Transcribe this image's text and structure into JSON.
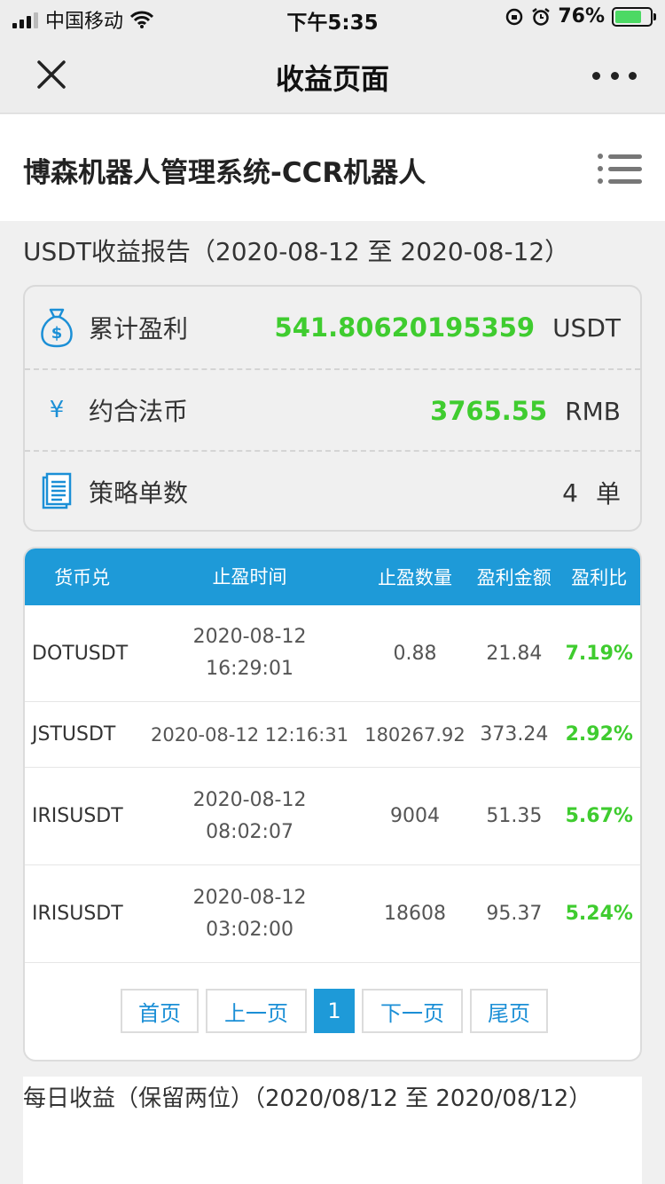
{
  "status_bar": {
    "carrier": "中国移动",
    "time": "下午5:35",
    "battery_pct": "76%",
    "battery_level": 0.76
  },
  "nav": {
    "title": "收益页面"
  },
  "header": {
    "title": "博森机器人管理系统-CCR机器人"
  },
  "report": {
    "title": "USDT收益报告（2020-08-12 至 2020-08-12）"
  },
  "summary": {
    "profit": {
      "label": "累计盈利",
      "value": "541.80620195359",
      "unit": "USDT",
      "icon": "money-bag-icon"
    },
    "fiat": {
      "label": "约合法币",
      "symbol": "¥",
      "value": "3765.55",
      "unit": "RMB"
    },
    "orders": {
      "label": "策略单数",
      "value": "4",
      "unit": "单",
      "icon": "document-icon"
    }
  },
  "table": {
    "headers": [
      "货币兑",
      "止盈时间",
      "止盈数量",
      "盈利金额",
      "盈利比"
    ],
    "rows": [
      {
        "pair": "DOTUSDT",
        "date": "2020-08-12",
        "time": "16:29:01",
        "qty": "0.88",
        "amount": "21.84",
        "ratio": "7.19%"
      },
      {
        "pair": "JSTUSDT",
        "datetime": "2020-08-12 12:16:31",
        "qty": "180267.92",
        "amount": "373.24",
        "ratio": "2.92%"
      },
      {
        "pair": "IRISUSDT",
        "date": "2020-08-12",
        "time": "08:02:07",
        "qty": "9004",
        "amount": "51.35",
        "ratio": "5.67%"
      },
      {
        "pair": "IRISUSDT",
        "date": "2020-08-12",
        "time": "03:02:00",
        "qty": "18608",
        "amount": "95.37",
        "ratio": "5.24%"
      }
    ]
  },
  "pager": {
    "first": "首页",
    "prev": "上一页",
    "current": "1",
    "next": "下一页",
    "last": "尾页"
  },
  "daily": {
    "title": "每日收益（保留两位）（2020/08/12 至 2020/08/12）"
  },
  "colors": {
    "accent": "#1e9ad8",
    "positive": "#3fcc2f"
  }
}
